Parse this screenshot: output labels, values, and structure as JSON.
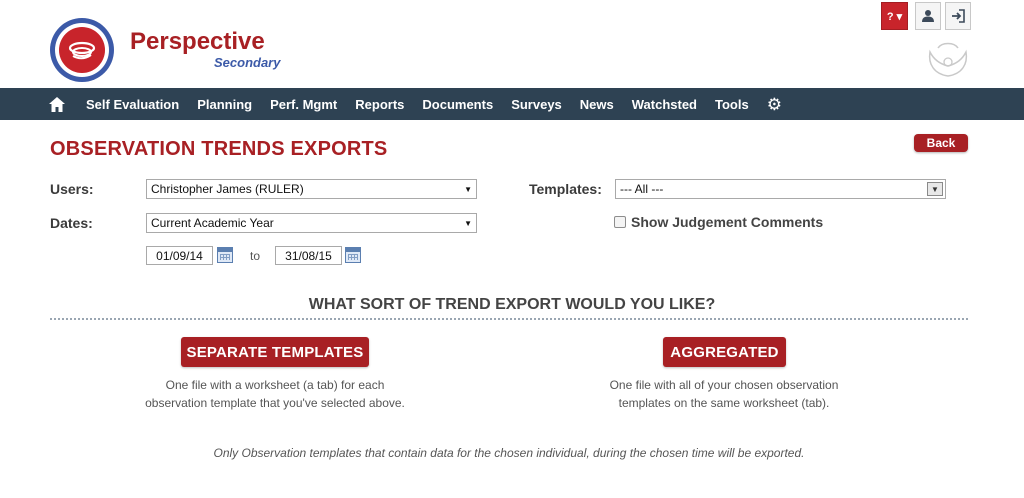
{
  "header": {
    "app_name": "Perspective",
    "app_subtitle": "Secondary",
    "help_label": "? ▾",
    "user_icon": "user-icon",
    "logout_icon": "logout-icon"
  },
  "nav": {
    "home_icon": "home-icon",
    "items": [
      "Self Evaluation",
      "Planning",
      "Perf. Mgmt",
      "Reports",
      "Documents",
      "Surveys",
      "News",
      "Watchsted",
      "Tools"
    ],
    "settings_icon": "gear-icon"
  },
  "page": {
    "title": "OBSERVATION TRENDS EXPORTS",
    "back_label": "Back"
  },
  "form": {
    "users_label": "Users:",
    "users_value": "Christopher James (RULER)",
    "dates_label": "Dates:",
    "dates_value": "Current Academic Year",
    "templates_label": "Templates:",
    "templates_value": "--- All ---",
    "show_judgement_label": "Show Judgement Comments",
    "show_judgement_checked": false,
    "date_from": "01/09/14",
    "date_to_word": "to",
    "date_to": "31/08/15"
  },
  "export": {
    "question": "WHAT SORT OF TREND EXPORT WOULD YOU LIKE?",
    "separate": {
      "label": "SEPARATE TEMPLATES",
      "line1": "One file with a worksheet (a tab) for each",
      "line2": "observation template that you've selected above."
    },
    "aggregated": {
      "label": "AGGREGATED",
      "line1": "One file with all of your chosen observation",
      "line2": "templates on the same worksheet (tab)."
    },
    "footnote": "Only Observation templates that contain data for the chosen individual, during the chosen time will be exported."
  },
  "colors": {
    "brand_red": "#a82024",
    "nav_bg": "#2e4253",
    "logo_blue": "#3c5aa8"
  }
}
